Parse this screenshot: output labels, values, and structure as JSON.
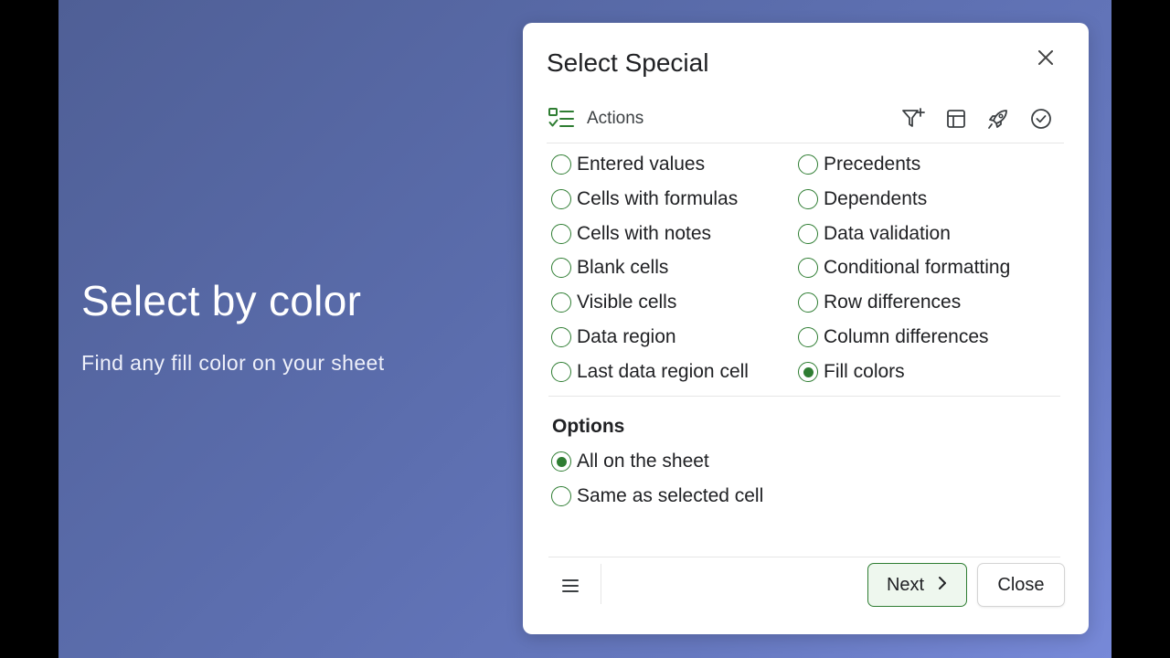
{
  "hero": {
    "title": "Select by color",
    "subtitle": "Find any fill color on your sheet"
  },
  "dialog": {
    "title": "Select Special",
    "close_icon": "close-icon",
    "actions_label": "Actions",
    "toolbar_icons": [
      "filter-plus-icon",
      "table-icon",
      "rocket-icon",
      "check-circle-icon"
    ],
    "left_options": [
      {
        "label": "Entered values",
        "checked": false
      },
      {
        "label": "Cells with formulas",
        "checked": false
      },
      {
        "label": "Cells with notes",
        "checked": false
      },
      {
        "label": "Blank cells",
        "checked": false
      },
      {
        "label": "Visible cells",
        "checked": false
      },
      {
        "label": "Data region",
        "checked": false
      },
      {
        "label": "Last data region cell",
        "checked": false
      }
    ],
    "right_options": [
      {
        "label": "Precedents",
        "checked": false
      },
      {
        "label": "Dependents",
        "checked": false
      },
      {
        "label": "Data validation",
        "checked": false
      },
      {
        "label": "Conditional formatting",
        "checked": false
      },
      {
        "label": "Row differences",
        "checked": false
      },
      {
        "label": "Column differences",
        "checked": false
      },
      {
        "label": "Fill colors",
        "checked": true
      }
    ],
    "options_heading": "Options",
    "scope_options": [
      {
        "label": "All on the sheet",
        "checked": true
      },
      {
        "label": "Same as selected cell",
        "checked": false
      }
    ],
    "footer": {
      "menu_icon": "menu-icon",
      "next_label": "Next",
      "close_label": "Close"
    }
  },
  "colors": {
    "accent": "#2e7d32",
    "background_start": "#4f5f96",
    "background_end": "#7789d8"
  }
}
